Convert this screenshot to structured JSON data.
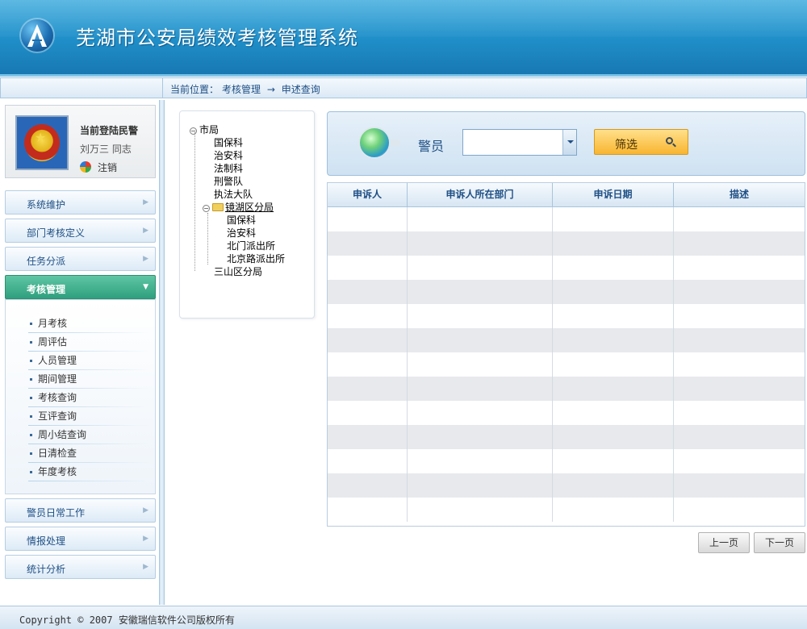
{
  "header": {
    "title": "芜湖市公安局绩效考核管理系统",
    "logo_icon": "police-a-logo"
  },
  "breadcrumb": {
    "prefix": "当前位置：",
    "path": [
      "考核管理",
      "申述查询"
    ],
    "separator": "→"
  },
  "user": {
    "title": "当前登陆民警",
    "name": "刘万三  同志",
    "logout": "注销"
  },
  "menu": [
    {
      "label": "系统维护",
      "active": false
    },
    {
      "label": "部门考核定义",
      "active": false
    },
    {
      "label": "任务分派",
      "active": false
    },
    {
      "label": "考核管理",
      "active": true
    },
    {
      "label": "警员日常工作",
      "active": false
    },
    {
      "label": "情报处理",
      "active": false
    },
    {
      "label": "统计分析",
      "active": false
    }
  ],
  "submenu": [
    "月考核",
    "周评估",
    "人员管理",
    "期间管理",
    "考核查询",
    "互评查询",
    "周小结查询",
    "日清检查",
    "年度考核"
  ],
  "tree": [
    {
      "label": "市局",
      "toggle": "−"
    },
    {
      "label": "国保科"
    },
    {
      "label": "治安科"
    },
    {
      "label": "法制科"
    },
    {
      "label": "刑警队"
    },
    {
      "label": "执法大队"
    },
    {
      "label": "镜湖区分局",
      "toggle": "−",
      "selected": true
    },
    {
      "label": "国保科"
    },
    {
      "label": "治安科"
    },
    {
      "label": "北门派出所"
    },
    {
      "label": "北京路派出所"
    },
    {
      "label": "三山区分局"
    }
  ],
  "filter": {
    "label": "警员",
    "selected_value": "",
    "button": "筛选"
  },
  "table": {
    "columns": [
      "申诉人",
      "申诉人所在部门",
      "申诉日期",
      "描述"
    ],
    "rows": [],
    "empty_row_count": 13
  },
  "pager": {
    "prev": "上一页",
    "next": "下一页"
  },
  "footer": {
    "copyright": "Copyright © 2007 安徽瑞信软件公司版权所有"
  },
  "colors": {
    "header": "#1f8ec8",
    "active_menu": "#2f9f7d",
    "filter_button": "#f8b531"
  }
}
